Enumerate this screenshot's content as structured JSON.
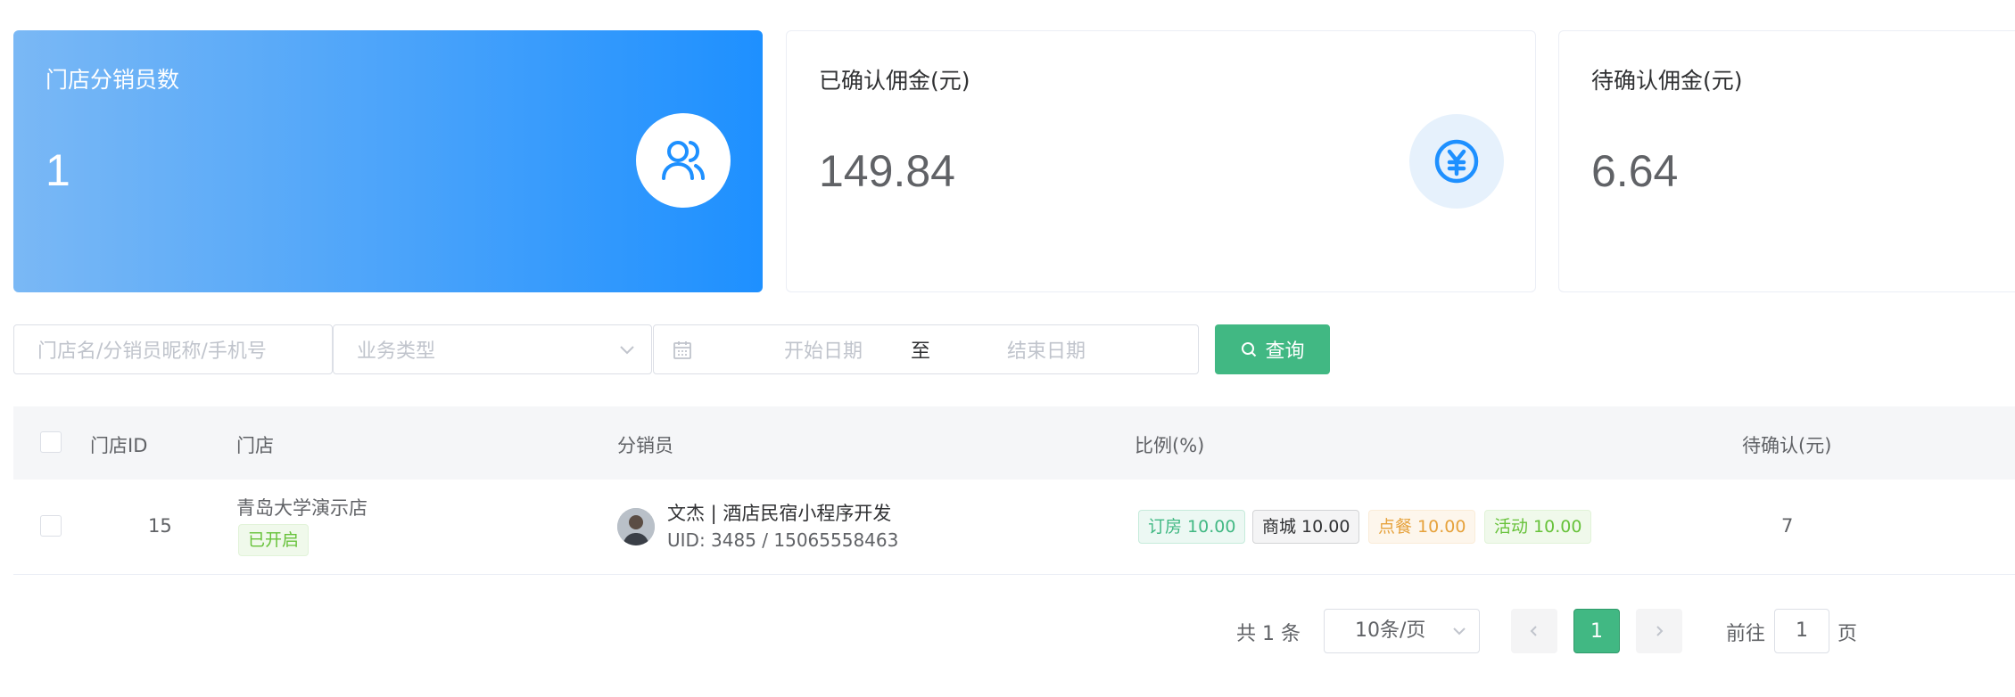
{
  "stats": {
    "distributors": {
      "title": "门店分销员数",
      "value": "1",
      "icon": "users-icon"
    },
    "confirmed": {
      "title": "已确认佣金(元)",
      "value": "149.84",
      "icon": "yen-icon"
    },
    "pending": {
      "title": "待确认佣金(元)",
      "value": "6.64"
    }
  },
  "filters": {
    "search_placeholder": "门店名/分销员昵称/手机号",
    "type_placeholder": "业务类型",
    "start_date_placeholder": "开始日期",
    "date_separator": "至",
    "end_date_placeholder": "结束日期",
    "query_label": "查询"
  },
  "table": {
    "headers": {
      "store_id": "门店ID",
      "store": "门店",
      "distributor": "分销员",
      "ratio": "比例(%)",
      "pending": "待确认(元)"
    },
    "rows": [
      {
        "store_id": "15",
        "store_name": "青岛大学演示店",
        "store_status": "已开启",
        "distributor_name": "文杰 | 酒店民宿小程序开发",
        "distributor_uid": "UID: 3485 / 15065558463",
        "ratios": {
          "room": "订房 10.00",
          "mall": "商城 10.00",
          "food": "点餐 10.00",
          "activity": "活动 10.00"
        },
        "pending": "7"
      }
    ]
  },
  "pagination": {
    "total": "共 1 条",
    "page_size": "10条/页",
    "current": "1",
    "goto_label": "前往",
    "goto_value": "1",
    "page_label": "页"
  },
  "colors": {
    "primary": "#1e90ff",
    "success": "#41b883"
  }
}
